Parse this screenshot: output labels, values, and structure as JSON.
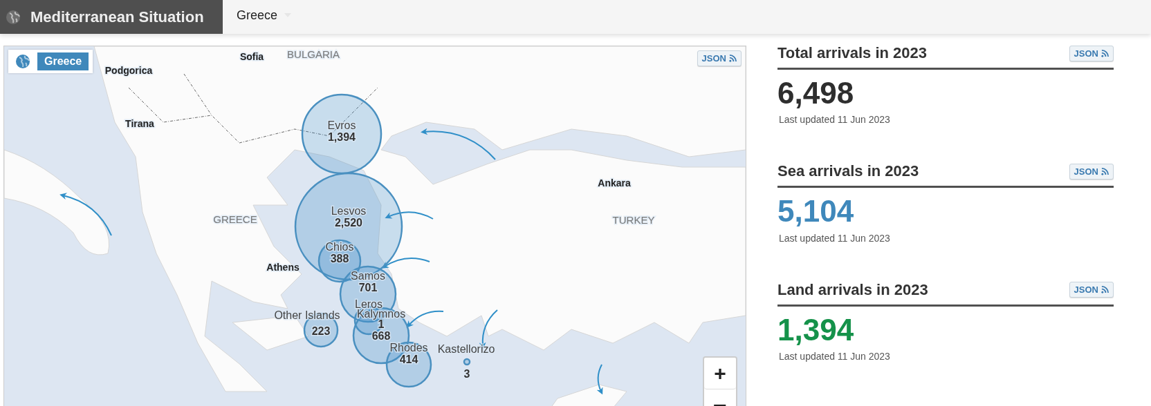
{
  "header": {
    "title": "Mediterranean Situation",
    "country_selector": {
      "value": "Greece"
    }
  },
  "map": {
    "badge": "Greece",
    "json_button": "JSON",
    "place_labels": [
      {
        "kind": "city",
        "text": "Sofia"
      },
      {
        "kind": "country",
        "text": "BULGARIA"
      },
      {
        "kind": "city",
        "text": "Podgorica"
      },
      {
        "kind": "city",
        "text": "Tirana"
      },
      {
        "kind": "country",
        "text": "GREECE"
      },
      {
        "kind": "city",
        "text": "Athens"
      },
      {
        "kind": "city",
        "text": "Ankara"
      },
      {
        "kind": "country",
        "text": "TURKEY"
      }
    ],
    "sites": [
      {
        "name": "Evros",
        "count": "1,394"
      },
      {
        "name": "Lesvos",
        "count": "2,520"
      },
      {
        "name": "Chios",
        "count": "388"
      },
      {
        "name": "Samos",
        "count": "701"
      },
      {
        "name": "Leros"
      },
      {
        "name": "Kalymnos",
        "count": "1"
      },
      {
        "count": "668"
      },
      {
        "name": "Other Islands",
        "count": "223"
      },
      {
        "name": "Rhodes",
        "count": "414"
      },
      {
        "name": "Kastellorizo",
        "count": "3"
      }
    ],
    "zoom_controls": [
      {
        "kind": "zoom-in",
        "text": "+"
      },
      {
        "kind": "zoom-out",
        "text": "−"
      }
    ]
  },
  "stats": [
    {
      "title": "Total arrivals in 2023",
      "json_button": "JSON",
      "value": "6,498",
      "color": "#2e2e2e",
      "updated": "Last updated 11 Jun 2023"
    },
    {
      "title": "Sea arrivals in 2023",
      "json_button": "JSON",
      "value": "5,104",
      "color": "#3f88bb",
      "updated": "Last updated 11 Jun 2023"
    },
    {
      "title": "Land arrivals in 2023",
      "json_button": "JSON",
      "value": "1,394",
      "color": "#15924a",
      "updated": "Last updated 11 Jun 2023"
    }
  ]
}
